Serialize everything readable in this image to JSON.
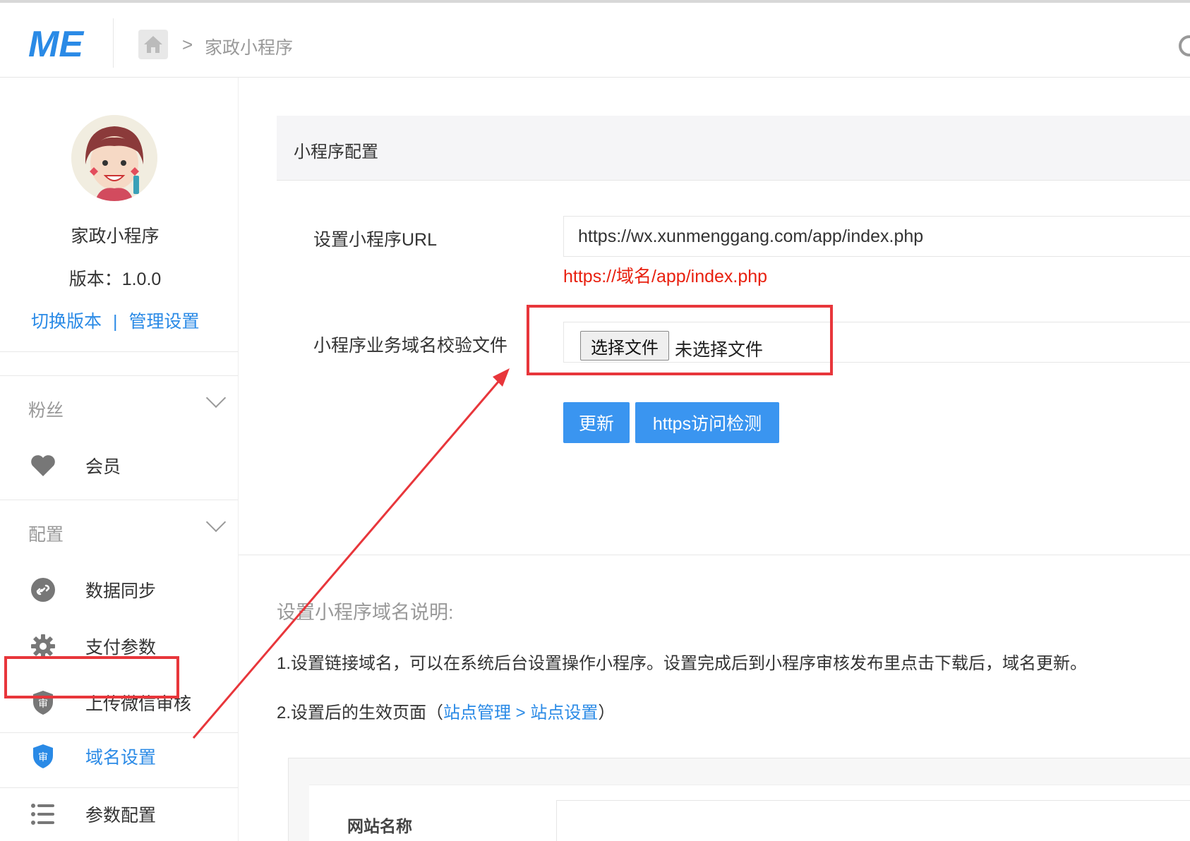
{
  "topbar": {
    "logo_text": "ME",
    "breadcrumb_separator": ">",
    "breadcrumb_title": "家政小程序"
  },
  "sidebar": {
    "app_name": "家政小程序",
    "version_text": "版本：1.0.0",
    "switch_version": "切换版本",
    "link_separator": "|",
    "manage_settings": "管理设置",
    "groups": [
      {
        "title": "粉丝",
        "items": [
          {
            "label": "会员",
            "icon": "heart-icon"
          }
        ]
      },
      {
        "title": "配置",
        "items": [
          {
            "label": "数据同步",
            "icon": "link-icon"
          },
          {
            "label": "支付参数",
            "icon": "gear-icon"
          },
          {
            "label": "上传微信审核",
            "icon": "shield-icon"
          },
          {
            "label": "域名设置",
            "icon": "shield-icon",
            "active": true
          },
          {
            "label": "参数配置",
            "icon": "list-icon"
          }
        ]
      }
    ]
  },
  "main": {
    "panel_title": "小程序配置",
    "url_label": "设置小程序URL",
    "url_value": "https://wx.xunmenggang.com/app/index.php",
    "url_hint": "https://域名/app/index.php",
    "verify_label": "小程序业务域名校验文件",
    "file_button": "选择文件",
    "file_status": "未选择文件",
    "update_button": "更新",
    "https_check_button": "https访问检测",
    "desc_title": "设置小程序域名说明:",
    "desc_1": "1.设置链接域名，可以在系统后台设置操作小程序。设置完成后到小程序审核发布里点击下载后，域名更新。",
    "desc_2_prefix": "2.设置后的生效页面（",
    "desc_2_link1": "站点管理",
    "desc_2_arrow": " > ",
    "desc_2_link2": "站点设置",
    "desc_2_suffix": "）",
    "preview_label": "网站名称"
  },
  "colors": {
    "accent": "#2a8ae6",
    "button": "#3a95f0",
    "annotation_red": "#e8363b",
    "hint_red": "#e8200f"
  }
}
